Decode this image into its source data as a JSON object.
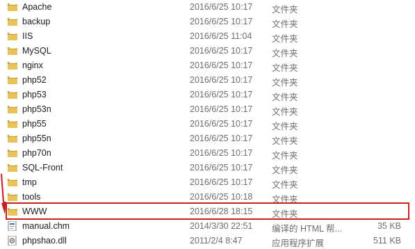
{
  "files": [
    {
      "name": "Apache",
      "date": "2016/6/25 10:17",
      "type": "文件夹",
      "size": "",
      "icon": "folder-icon"
    },
    {
      "name": "backup",
      "date": "2016/6/25 10:17",
      "type": "文件夹",
      "size": "",
      "icon": "folder-icon"
    },
    {
      "name": "IIS",
      "date": "2016/6/25 11:04",
      "type": "文件夹",
      "size": "",
      "icon": "folder-icon"
    },
    {
      "name": "MySQL",
      "date": "2016/6/25 10:17",
      "type": "文件夹",
      "size": "",
      "icon": "folder-icon"
    },
    {
      "name": "nginx",
      "date": "2016/6/25 10:17",
      "type": "文件夹",
      "size": "",
      "icon": "folder-icon"
    },
    {
      "name": "php52",
      "date": "2016/6/25 10:17",
      "type": "文件夹",
      "size": "",
      "icon": "folder-icon"
    },
    {
      "name": "php53",
      "date": "2016/6/25 10:17",
      "type": "文件夹",
      "size": "",
      "icon": "folder-icon"
    },
    {
      "name": "php53n",
      "date": "2016/6/25 10:17",
      "type": "文件夹",
      "size": "",
      "icon": "folder-icon"
    },
    {
      "name": "php55",
      "date": "2016/6/25 10:17",
      "type": "文件夹",
      "size": "",
      "icon": "folder-icon"
    },
    {
      "name": "php55n",
      "date": "2016/6/25 10:17",
      "type": "文件夹",
      "size": "",
      "icon": "folder-icon"
    },
    {
      "name": "php70n",
      "date": "2016/6/25 10:17",
      "type": "文件夹",
      "size": "",
      "icon": "folder-icon"
    },
    {
      "name": "SQL-Front",
      "date": "2016/6/25 10:17",
      "type": "文件夹",
      "size": "",
      "icon": "folder-icon"
    },
    {
      "name": "tmp",
      "date": "2016/6/25 10:17",
      "type": "文件夹",
      "size": "",
      "icon": "folder-icon"
    },
    {
      "name": "tools",
      "date": "2016/6/25 10:18",
      "type": "文件夹",
      "size": "",
      "icon": "folder-icon"
    },
    {
      "name": "WWW",
      "date": "2016/6/28 18:15",
      "type": "文件夹",
      "size": "",
      "icon": "folder-icon",
      "highlighted": true
    },
    {
      "name": "manual.chm",
      "date": "2014/3/30 22:51",
      "type": "编译的 HTML 帮...",
      "size": "35 KB",
      "icon": "chm-file-icon"
    },
    {
      "name": "phpshao.dll",
      "date": "2011/2/4 8:47",
      "type": "应用程序扩展",
      "size": "511 KB",
      "icon": "dll-file-icon"
    }
  ],
  "annotation": {
    "highlight_color": "#c9201f"
  },
  "colors": {
    "folder": "#e8c25a",
    "folder_dark": "#c99a2e",
    "text_secondary": "#6d6d6d"
  }
}
